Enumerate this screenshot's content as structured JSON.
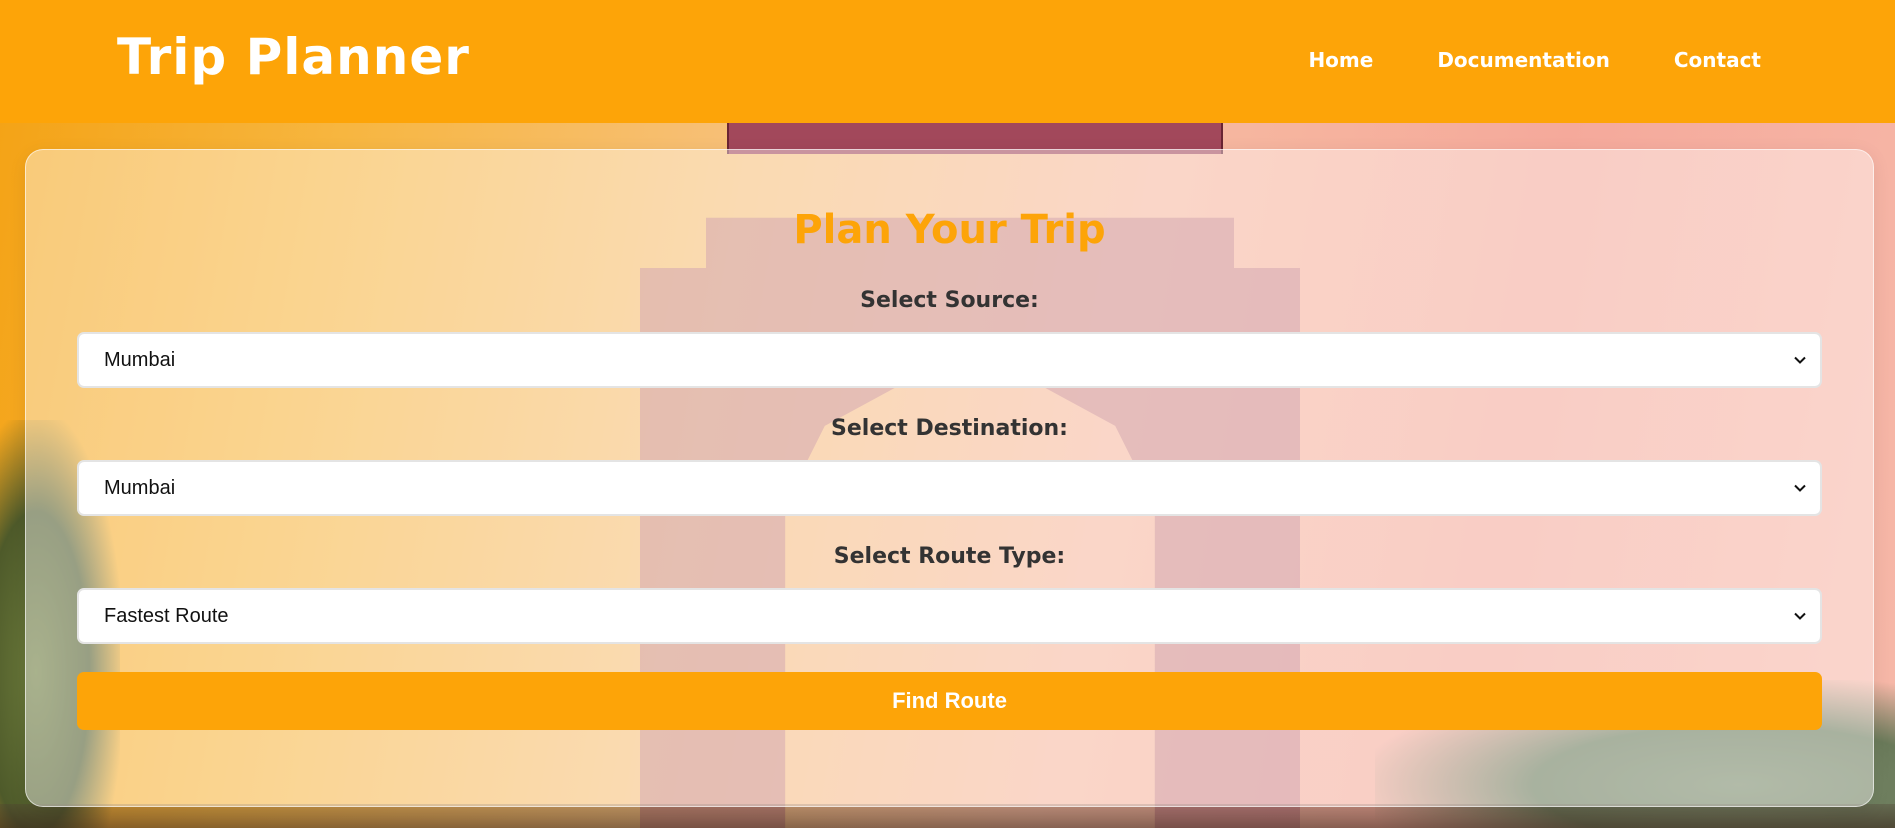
{
  "header": {
    "brand": "Trip Planner",
    "nav": [
      "Home",
      "Documentation",
      "Contact"
    ]
  },
  "form": {
    "title": "Plan Your Trip",
    "source_label": "Select Source:",
    "source_value": "Mumbai",
    "destination_label": "Select Destination:",
    "destination_value": "Mumbai",
    "route_type_label": "Select Route Type:",
    "route_type_value": "Fastest Route",
    "submit_label": "Find Route"
  },
  "colors": {
    "accent": "#fda408",
    "label_text": "#333333"
  },
  "icons": {
    "select_arrow": "chevron-down-icon"
  }
}
